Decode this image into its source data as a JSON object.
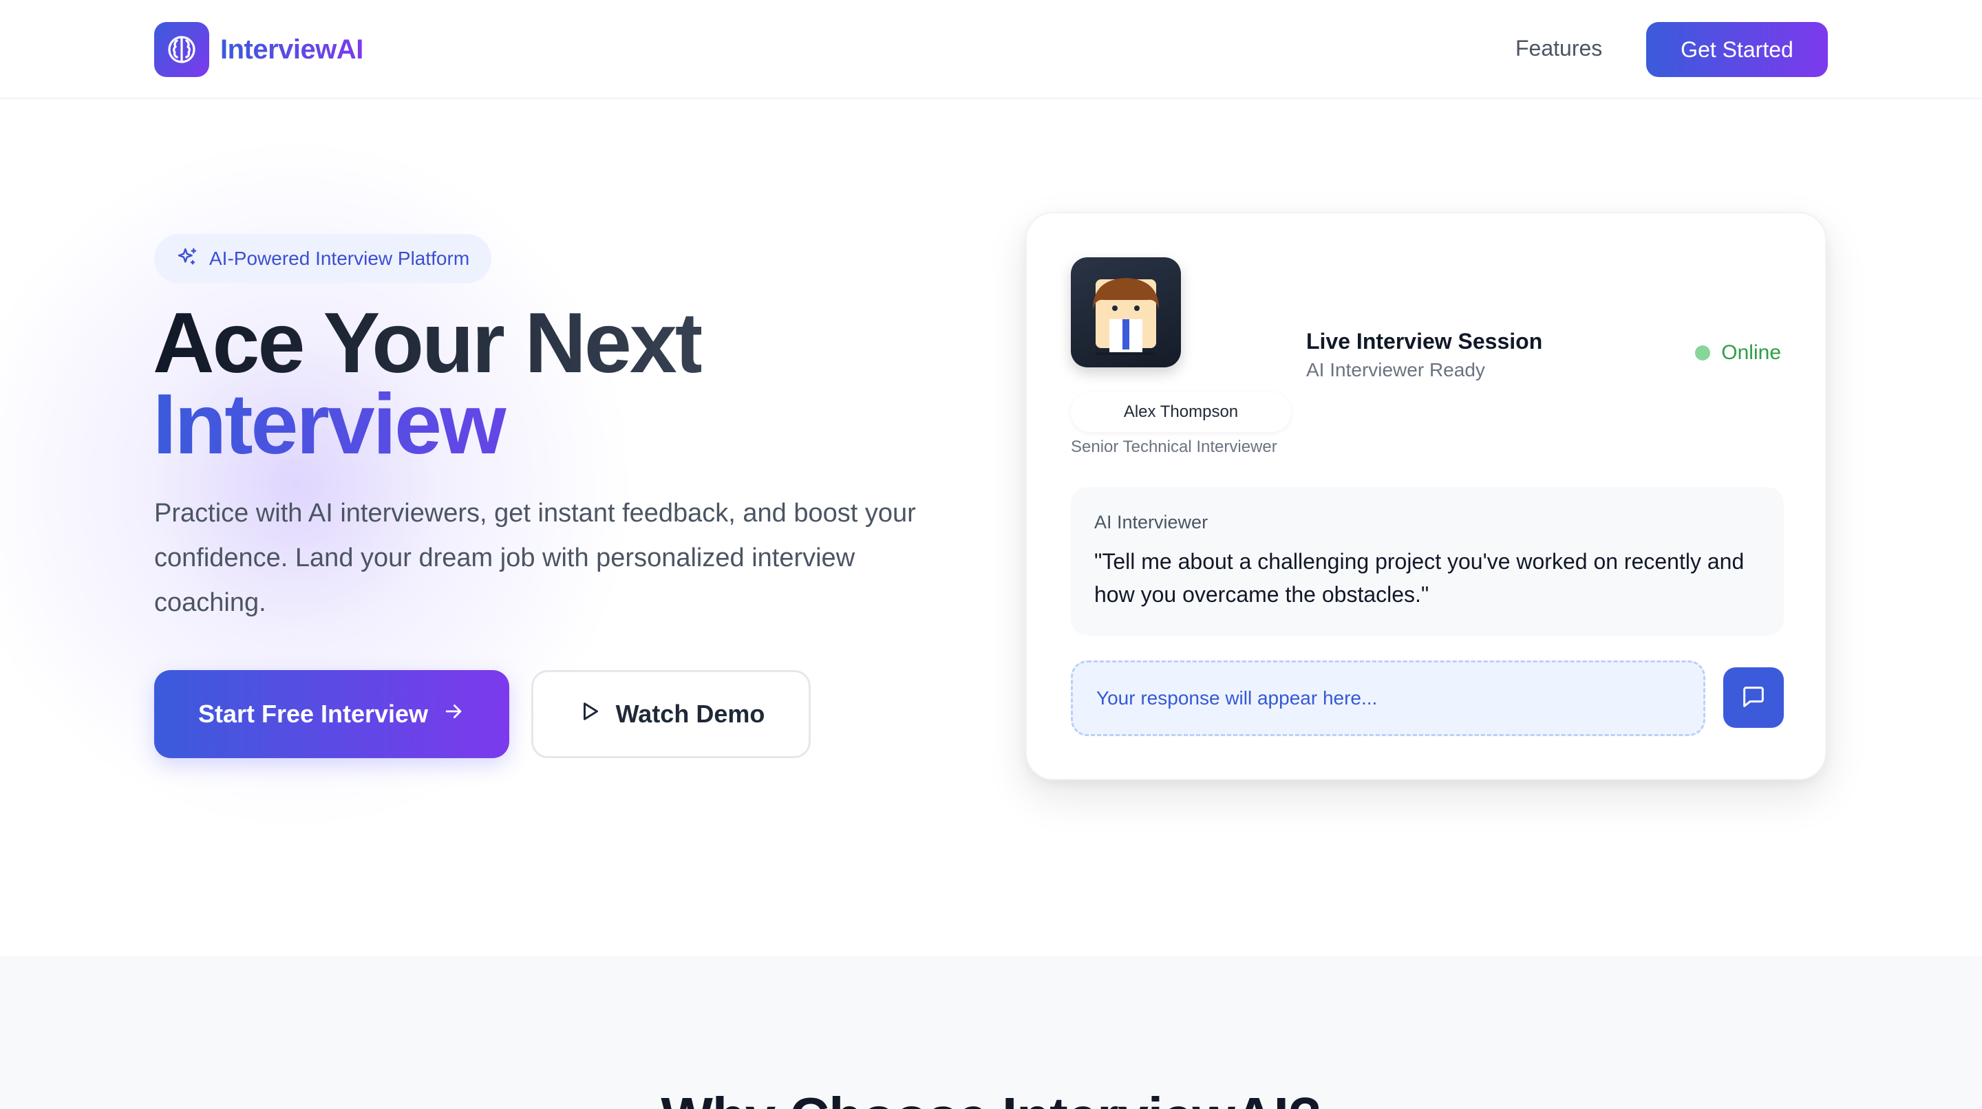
{
  "header": {
    "brand": "InterviewAI",
    "nav": {
      "features": "Features"
    },
    "cta": "Get Started"
  },
  "hero": {
    "badge": "AI-Powered Interview Platform",
    "title_line1": "Ace Your Next",
    "title_line2": "Interview",
    "description": "Practice with AI interviewers, get instant feedback, and boost your confidence. Land your dream job with personalized interview coaching.",
    "primary_button": "Start Free Interview",
    "secondary_button": "Watch Demo"
  },
  "card": {
    "interviewer_name": "Alex Thompson",
    "interviewer_role": "Senior Technical Interviewer",
    "session_title": "Live Interview Session",
    "session_subtitle": "AI Interviewer Ready",
    "status": "Online",
    "message_label": "AI Interviewer",
    "message_text": "\"Tell me about a challenging project you've worked on recently and how you overcame the obstacles.\"",
    "response_placeholder": "Your response will appear here..."
  },
  "features": {
    "title": "Why Choose InterviewAI?"
  },
  "colors": {
    "accent_start": "#3b5bdb",
    "accent_end": "#7c3aed",
    "online": "#2f9e44"
  },
  "icons": {
    "logo": "brain-icon",
    "badge": "sparkles-icon",
    "primary_button": "arrow-right-icon",
    "secondary_button": "play-icon",
    "send": "message-square-icon"
  }
}
